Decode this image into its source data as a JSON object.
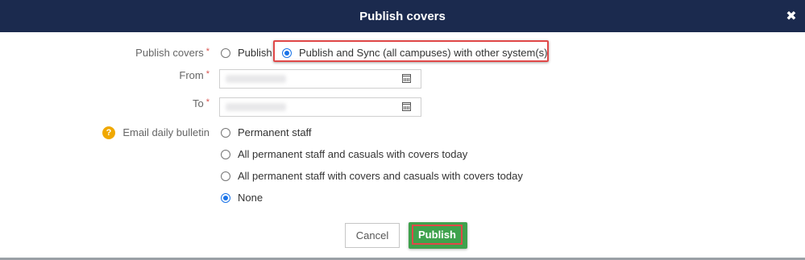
{
  "dialog": {
    "title": "Publish covers",
    "close_symbol": "✖"
  },
  "form": {
    "publish_covers": {
      "label": "Publish covers",
      "required_mark": "*",
      "options": [
        {
          "label": "Publish",
          "checked": false
        },
        {
          "label": "Publish and Sync (all campuses) with other system(s)",
          "checked": true
        }
      ]
    },
    "from": {
      "label": "From",
      "required_mark": "*",
      "value": "",
      "icon": "calendar-icon"
    },
    "to": {
      "label": "To",
      "required_mark": "*",
      "value": "",
      "icon": "calendar-icon"
    },
    "email_daily_bulletin": {
      "label": "Email daily bulletin",
      "help_icon": "?",
      "options": [
        {
          "label": "Permanent staff",
          "checked": false
        },
        {
          "label": "All permanent staff and casuals with covers today",
          "checked": false
        },
        {
          "label": "All permanent staff with covers and casuals with covers today",
          "checked": false
        },
        {
          "label": "None",
          "checked": true
        }
      ]
    }
  },
  "buttons": {
    "cancel_label": "Cancel",
    "publish_label": "Publish"
  },
  "colors": {
    "title_bar": "#1b2a4e",
    "publish_button": "#3fa24d",
    "highlight": "#e04848",
    "radio_accent": "#1a73e8",
    "required": "#d9534f",
    "help_icon": "#f0a800"
  }
}
